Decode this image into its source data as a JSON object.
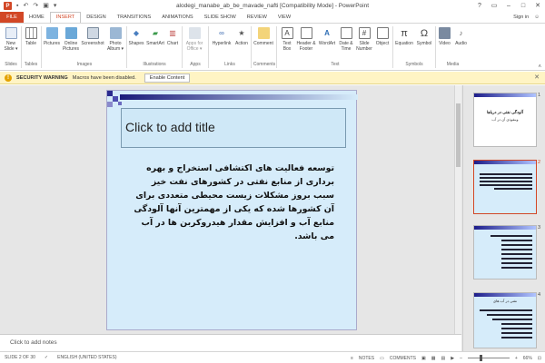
{
  "window": {
    "title": "alodegi_manabe_ab_be_mavade_nafti [Compatibility Mode] - PowerPoint",
    "app_icon": "P",
    "controls": [
      "?",
      "▭",
      "–",
      "□",
      "✕"
    ]
  },
  "tabs": [
    "FILE",
    "HOME",
    "INSERT",
    "DESIGN",
    "TRANSITIONS",
    "ANIMATIONS",
    "SLIDE SHOW",
    "REVIEW",
    "VIEW"
  ],
  "active_tab": "INSERT",
  "signin": "Sign in",
  "ribbon": {
    "buttons": {
      "new_slide": "New Slide ▾",
      "table": "Table",
      "pictures": "Pictures",
      "online_pictures": "Online Pictures",
      "screenshot": "Screenshot",
      "photo_album": "Photo Album ▾",
      "shapes": "Shapes",
      "smartart": "SmartArt",
      "chart": "Chart",
      "apps_for_office": "Apps for Office ▾",
      "hyperlink": "Hyperlink",
      "action": "Action",
      "comment": "Comment",
      "text_box": "Text Box",
      "header_footer": "Header & Footer",
      "wordart": "WordArt",
      "date_time": "Date & Time",
      "slide_number": "Slide Number",
      "object": "Object",
      "equation": "Equation",
      "symbol": "Symbol",
      "video": "Video",
      "audio": "Audio"
    },
    "groups": {
      "slides": "Slides",
      "tables": "Tables",
      "images": "Images",
      "illustrations": "Illustrations",
      "apps": "Apps",
      "links": "Links",
      "comments": "Comments",
      "text": "Text",
      "symbols": "Symbols",
      "media": "Media"
    }
  },
  "security": {
    "title": "SECURITY WARNING",
    "message": "Macros have been disabled.",
    "button": "Enable Content"
  },
  "slide": {
    "title_placeholder": "Click to add title",
    "body": "توسعه فعالیت های اکتشافی استخراج و بهره برداری از منابع نفتی در کشورهای نفت خیز سبب بروز مشکلات زیست محیطی متعددی برای آن کشورها شده که یکی از مهمترین آنها آلودگی منابع آب و افزایش مقدار هیدروکربن ها در آب می باشد."
  },
  "notes_placeholder": "Click to add notes",
  "thumbnails": [
    {
      "number": "1",
      "title": "آلودگی نفتی در دریاها",
      "subtitle": "وبنفوذی آن در آب"
    },
    {
      "number": "2"
    },
    {
      "number": "3"
    },
    {
      "number": "4",
      "title": "نفتی در آب های"
    }
  ],
  "status": {
    "slide_of": "SLIDE 2 OF 30",
    "language": "ENGLISH (UNITED STATES)",
    "notes": "NOTES",
    "comments": "COMMENTS",
    "zoom": "66%",
    "zoom_level": 0.66
  },
  "colors": {
    "accent": "#d24726",
    "slide_bg": "#d6ecfa",
    "warning_bar": "#fff4c4"
  }
}
